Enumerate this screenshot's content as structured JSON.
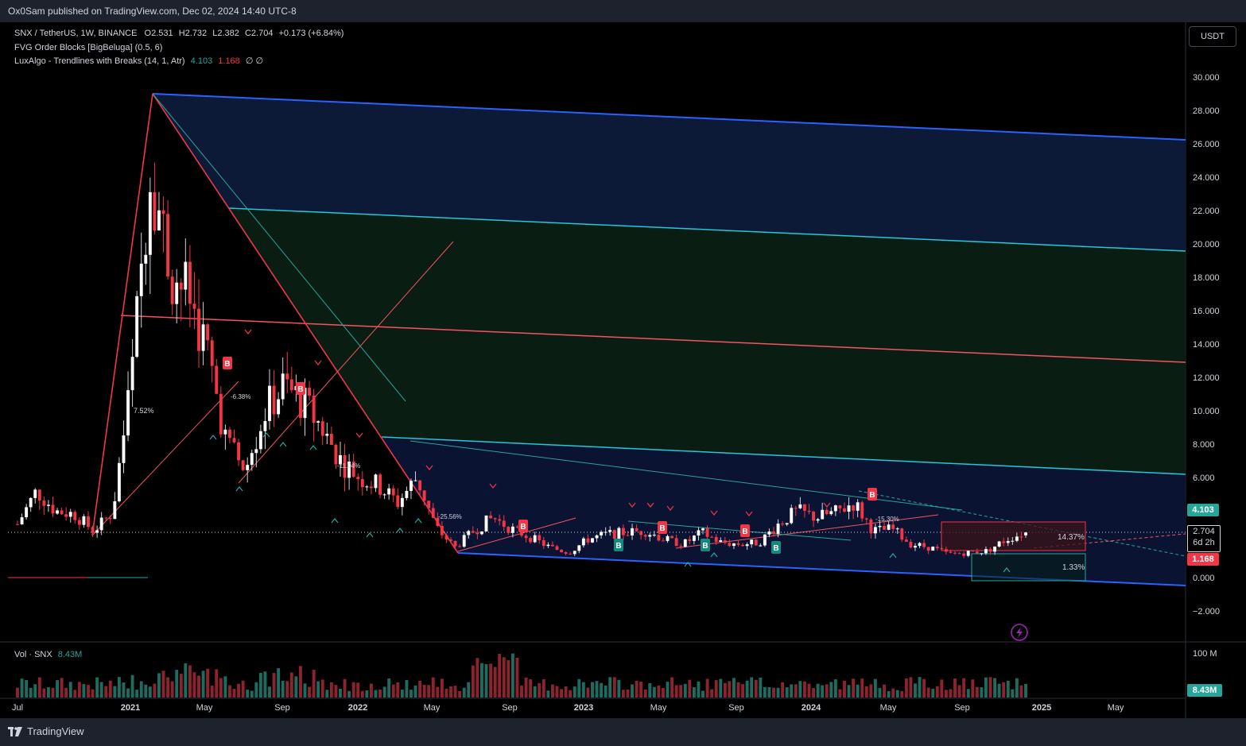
{
  "header": {
    "published": "Ox0Sam published on TradingView.com, Dec 02, 2024 14:40 UTC-8"
  },
  "legend": {
    "symbol": "SNX / TetherUS, 1W, BINANCE",
    "open_label": "O",
    "open": "2.531",
    "high_label": "H",
    "high": "2.732",
    "low_label": "L",
    "low": "2.382",
    "close_label": "C",
    "close": "2.704",
    "change": "+0.173 (+6.84%)",
    "indicator1": "FVG Order Blocks [BigBeluga] (0.5, 6)",
    "indicator2": "LuxAlgo - Trendlines with Breaks (14, 1, Atr)",
    "indicator2_v1": "4.103",
    "indicator2_v2": "1.168",
    "indicator2_tail": "∅  ∅"
  },
  "currency_button": "USDT",
  "price_badges": {
    "upper": "4.103",
    "last": "2.704",
    "countdown": "6d 2h",
    "lower": "1.168",
    "volume": "8.43M"
  },
  "volume_legend": {
    "label": "Vol · SNX",
    "value": "8.43M"
  },
  "volume_axis_label": "100 M",
  "annotations": {
    "box_top_pct": "14.37%",
    "box_bottom_pct": "1.33%",
    "pct_left": "7.52%",
    "pct_mid1": "-6.38%",
    "pct_mid2": "-11.04%",
    "pct_mid3": "-25.56%",
    "pct_right": "-15.30%"
  },
  "buy_label": "B",
  "branding": "TradingView",
  "colors": {
    "up": "#26a69a",
    "down": "#f23645",
    "channel_blue": "#2962ff",
    "teal_line": "#26c6da",
    "red_line": "#f7525f",
    "bg": "#000000"
  },
  "chart_data": {
    "type": "candlestick",
    "symbol": "SNX / TetherUS",
    "interval": "1W",
    "y_ticks": [
      30,
      28,
      26,
      24,
      22,
      20,
      18,
      16,
      14,
      12,
      10,
      8,
      6,
      4,
      2,
      0,
      -2
    ],
    "y_tick_labels": [
      "30.000",
      "28.000",
      "26.000",
      "24.000",
      "22.000",
      "20.000",
      "18.000",
      "16.000",
      "14.000",
      "12.000",
      "10.000",
      "8.000",
      "6.000",
      "4.000",
      "2.000",
      "0.000",
      "−2.000"
    ],
    "ylim": [
      -3,
      32
    ],
    "x_tick_labels": [
      "Jul",
      "2021",
      "May",
      "Sep",
      "2022",
      "May",
      "Sep",
      "2023",
      "May",
      "Sep",
      "2024",
      "May",
      "Sep",
      "2025",
      "May"
    ],
    "ohlc_last": {
      "open": 2.531,
      "high": 2.732,
      "low": 2.382,
      "close": 2.704
    },
    "price_path": [
      [
        "2020-07",
        3.2
      ],
      [
        "2020-08",
        5.2
      ],
      [
        "2020-09",
        4.0
      ],
      [
        "2020-10",
        3.8
      ],
      [
        "2020-11",
        2.8
      ],
      [
        "2020-12",
        3.9
      ],
      [
        "2021-01",
        12.0
      ],
      [
        "2021-02",
        25.0
      ],
      [
        "2021-03",
        18.5
      ],
      [
        "2021-04",
        17.0
      ],
      [
        "2021-05",
        13.5
      ],
      [
        "2021-06",
        8.0
      ],
      [
        "2021-07",
        6.5
      ],
      [
        "2021-08",
        10.0
      ],
      [
        "2021-09",
        11.5
      ],
      [
        "2021-10",
        10.5
      ],
      [
        "2021-11",
        9.0
      ],
      [
        "2021-12",
        7.0
      ],
      [
        "2022-01",
        6.0
      ],
      [
        "2022-02",
        5.5
      ],
      [
        "2022-03",
        4.5
      ],
      [
        "2022-04",
        6.0
      ],
      [
        "2022-05",
        3.0
      ],
      [
        "2022-06",
        1.8
      ],
      [
        "2022-07",
        2.8
      ],
      [
        "2022-08",
        3.6
      ],
      [
        "2022-09",
        2.9
      ],
      [
        "2022-10",
        2.4
      ],
      [
        "2022-11",
        1.8
      ],
      [
        "2022-12",
        1.5
      ],
      [
        "2023-01",
        2.3
      ],
      [
        "2023-02",
        2.6
      ],
      [
        "2023-03",
        2.7
      ],
      [
        "2023-04",
        2.8
      ],
      [
        "2023-05",
        2.3
      ],
      [
        "2023-06",
        2.0
      ],
      [
        "2023-07",
        2.7
      ],
      [
        "2023-08",
        2.1
      ],
      [
        "2023-09",
        2.0
      ],
      [
        "2023-10",
        2.1
      ],
      [
        "2023-11",
        3.2
      ],
      [
        "2023-12",
        4.0
      ],
      [
        "2024-01",
        3.6
      ],
      [
        "2024-02",
        3.9
      ],
      [
        "2024-03",
        4.5
      ],
      [
        "2024-04",
        2.8
      ],
      [
        "2024-05",
        2.9
      ],
      [
        "2024-06",
        2.0
      ],
      [
        "2024-07",
        1.8
      ],
      [
        "2024-08",
        1.4
      ],
      [
        "2024-09",
        1.5
      ],
      [
        "2024-10",
        1.6
      ],
      [
        "2024-11",
        2.3
      ],
      [
        "2024-12",
        2.704
      ]
    ],
    "volume_last": "8.43M",
    "grid": false
  }
}
